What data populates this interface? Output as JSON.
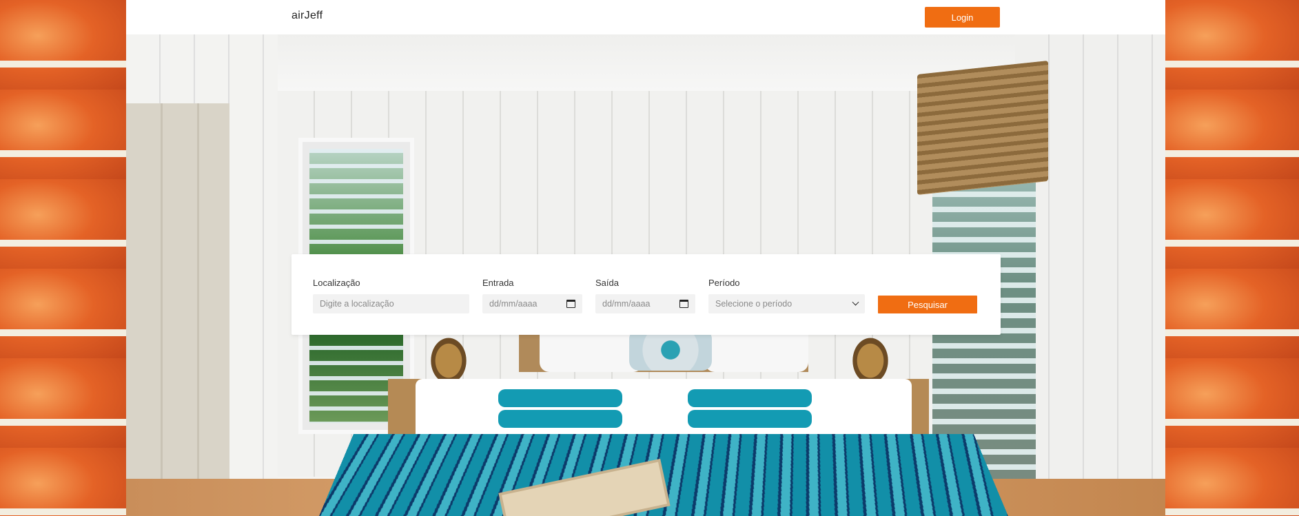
{
  "header": {
    "brand": "airJeff",
    "login_label": "Login"
  },
  "search": {
    "location": {
      "label": "Localização",
      "placeholder": "Digite a localização"
    },
    "checkin": {
      "label": "Entrada",
      "placeholder": "dd/mm/aaaa"
    },
    "checkout": {
      "label": "Saída",
      "placeholder": "dd/mm/aaaa"
    },
    "period": {
      "label": "Período",
      "selected": "Selecione o período"
    },
    "submit_label": "Pesquisar"
  },
  "colors": {
    "accent": "#f06d12",
    "card": "#ffffff",
    "input_bg": "#f2f2f2"
  },
  "icons": {
    "checkin_icon": "calendar-icon",
    "checkout_icon": "calendar-icon",
    "period_icon": "chevron-down-icon"
  }
}
